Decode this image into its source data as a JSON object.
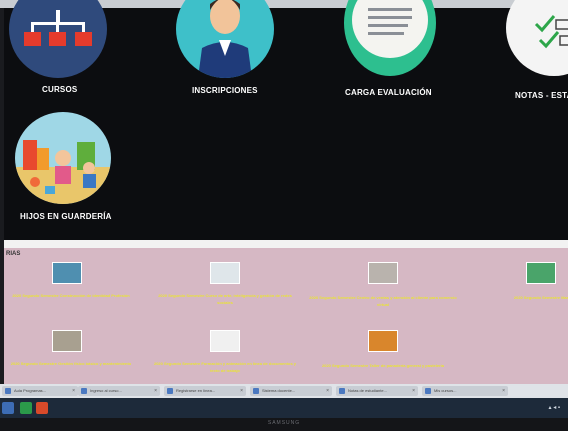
{
  "tiles": [
    {
      "label": "CURSOS"
    },
    {
      "label": "INSCRIPCIONES"
    },
    {
      "label": "CARGA EVALUACIÓN"
    },
    {
      "label": "NOTAS - ESTA"
    },
    {
      "label": "HIJOS EN GUARDERÍA"
    }
  ],
  "section": {
    "label": "RIAS"
  },
  "courses": [
    {
      "text": "2020 Segundo Semestre Construcción de identidad Profesión"
    },
    {
      "text": "2020 Segundo Semestre Curso de arte, inteligencia y gestión de redes sociales"
    },
    {
      "text": "2020 Segundo Semestre Centro de ventas y atención al cliente para comercio virtual"
    },
    {
      "text": "2020 Segundo Semestre Marketing"
    },
    {
      "text": "2020 Segundo Semestre Gestión físico básico y mantenimiento"
    },
    {
      "text": "2020 Segundo Semestre Formación y animación en línea de documentos y texto de trabajo"
    },
    {
      "text": "2020 Segundo Semestre Taller de panadería general y pastelería"
    }
  ],
  "tabs": [
    {
      "label": "Aula Programas..."
    },
    {
      "label": "Ingreso al curso..."
    },
    {
      "label": "Registrarse en línea..."
    },
    {
      "label": "Sistema docente..."
    },
    {
      "label": "Notas de estudiante..."
    },
    {
      "label": "Mis cursos..."
    }
  ],
  "brand": "SAMSUNG"
}
